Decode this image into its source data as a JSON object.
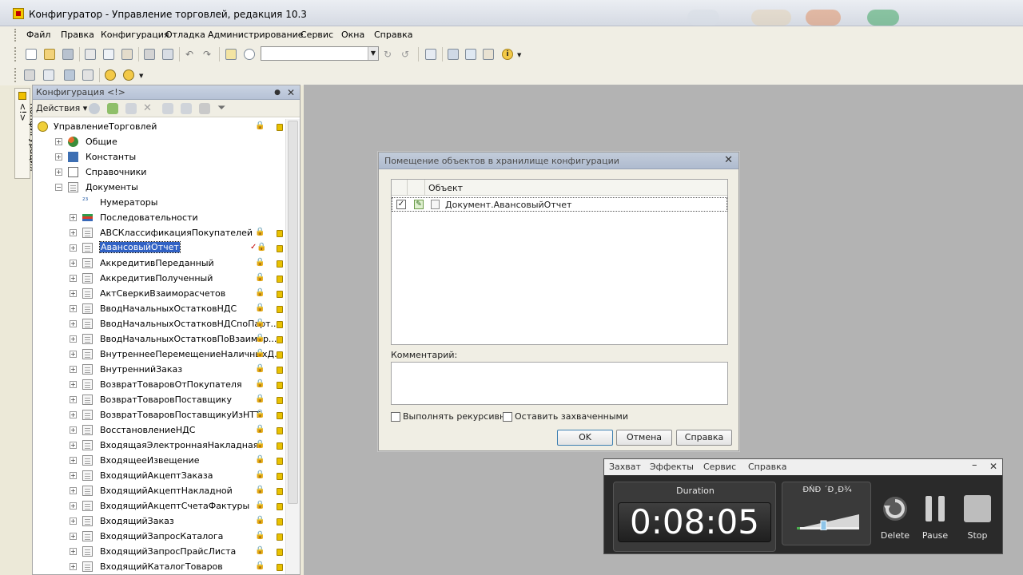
{
  "window": {
    "title": "Конфигуратор - Управление торговлей, редакция 10.3"
  },
  "menu": [
    "Файл",
    "Правка",
    "Конфигурация",
    "Отладка",
    "Администрирование",
    "Сервис",
    "Окна",
    "Справка"
  ],
  "side_tab": {
    "label": "Конфигурация <!>"
  },
  "config_panel": {
    "title": "Конфигурация <!>",
    "actions_label": "Действия",
    "tree": [
      {
        "label": "УправлениеТорговлей",
        "level": 0,
        "locked": true
      },
      {
        "label": "Общие",
        "level": 1
      },
      {
        "label": "Константы",
        "level": 1
      },
      {
        "label": "Справочники",
        "level": 1
      },
      {
        "label": "Документы",
        "level": 1,
        "expanded": true
      },
      {
        "label": "Нумераторы",
        "level": 2
      },
      {
        "label": "Последовательности",
        "level": 2
      },
      {
        "label": "АВСКлассификацияПокупателей",
        "level": 2,
        "locked": true
      },
      {
        "label": "АвансовыйОтчет",
        "level": 2,
        "locked": true,
        "selected": true
      },
      {
        "label": "АккредитивПереданный",
        "level": 2,
        "locked": true
      },
      {
        "label": "АккредитивПолученный",
        "level": 2,
        "locked": true
      },
      {
        "label": "АктСверкиВзаиморасчетов",
        "level": 2,
        "locked": true
      },
      {
        "label": "ВводНачальныхОстатковНДС",
        "level": 2,
        "locked": true
      },
      {
        "label": "ВводНачальныхОстатковНДСпоПарт...",
        "level": 2,
        "locked": true
      },
      {
        "label": "ВводНачальныхОстатковПоВзаимор...",
        "level": 2,
        "locked": true
      },
      {
        "label": "ВнутреннееПеремещениеНаличныхД...",
        "level": 2,
        "locked": true
      },
      {
        "label": "ВнутреннийЗаказ",
        "level": 2,
        "locked": true
      },
      {
        "label": "ВозвратТоваровОтПокупателя",
        "level": 2,
        "locked": true
      },
      {
        "label": "ВозвратТоваровПоставщику",
        "level": 2,
        "locked": true
      },
      {
        "label": "ВозвратТоваровПоставщикуИзНТТ",
        "level": 2,
        "locked": true
      },
      {
        "label": "ВосстановлениеНДС",
        "level": 2,
        "locked": true
      },
      {
        "label": "ВходящаяЭлектроннаяНакладная",
        "level": 2,
        "locked": true
      },
      {
        "label": "ВходящееИзвещение",
        "level": 2,
        "locked": true
      },
      {
        "label": "ВходящийАкцептЗаказа",
        "level": 2,
        "locked": true
      },
      {
        "label": "ВходящийАкцептНакладной",
        "level": 2,
        "locked": true
      },
      {
        "label": "ВходящийАкцептСчетаФактуры",
        "level": 2,
        "locked": true
      },
      {
        "label": "ВходящийЗаказ",
        "level": 2,
        "locked": true
      },
      {
        "label": "ВходящийЗапросКаталога",
        "level": 2,
        "locked": true
      },
      {
        "label": "ВходящийЗапросПрайсЛиста",
        "level": 2,
        "locked": true
      },
      {
        "label": "ВходящийКаталогТоваров",
        "level": 2,
        "locked": true
      }
    ]
  },
  "dialog": {
    "title": "Помещение объектов в хранилище конфигурации",
    "column_header": "Объект",
    "objects": [
      {
        "name": "Документ.АвансовыйОтчет",
        "checked": true
      }
    ],
    "comment_label": "Комментарий:",
    "comment_value": "",
    "recursive_label": "Выполнять рекурсивно",
    "keep_captured_label": "Оставить захваченными",
    "ok_label": "OK",
    "cancel_label": "Отмена",
    "help_label": "Справка"
  },
  "recorder": {
    "menu": [
      "Захват",
      "Эффекты",
      "Сервис",
      "Справка"
    ],
    "duration_label": "Duration",
    "duration_value": "0:08:05",
    "volume_label": "ĐŃĐ ´Đ¸Đ¾",
    "delete_label": "Delete",
    "pause_label": "Pause",
    "stop_label": "Stop"
  }
}
